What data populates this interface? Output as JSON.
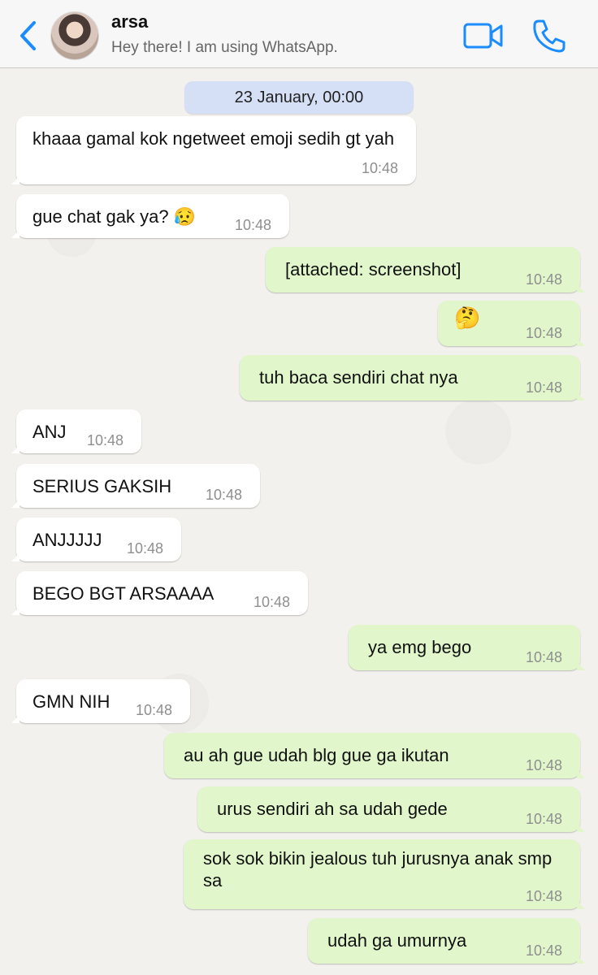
{
  "header": {
    "back_label": "Back",
    "contact_name": "arsa",
    "contact_status": "Hey there! I am using WhatsApp."
  },
  "chat": {
    "date_divider": "23 January, 00:00",
    "messages": [
      {
        "direction": "in",
        "text": " khaaa gamal kok ngetweet emoji sedih gt yah",
        "time": "10:48"
      },
      {
        "direction": "in",
        "text": "gue chat gak ya? 😥",
        "time": "10:48"
      },
      {
        "direction": "out",
        "text": "[attached: screenshot]",
        "time": "10:48"
      },
      {
        "direction": "out",
        "text": "🤔",
        "time": "10:48"
      },
      {
        "direction": "out",
        "text": "tuh baca sendiri chat nya",
        "time": "10:48"
      },
      {
        "direction": "in",
        "text": "ANJ",
        "time": "10:48"
      },
      {
        "direction": "in",
        "text": "SERIUS GAKSIH",
        "time": "10:48"
      },
      {
        "direction": "in",
        "text": "ANJJJJJ",
        "time": "10:48"
      },
      {
        "direction": "in",
        "text": "BEGO BGT ARSAAAA",
        "time": "10:48"
      },
      {
        "direction": "out",
        "text": "ya emg bego",
        "time": "10:48"
      },
      {
        "direction": "in",
        "text": "GMN NIH",
        "time": "10:48"
      },
      {
        "direction": "out",
        "text": "au ah gue udah blg gue ga ikutan",
        "time": "10:48"
      },
      {
        "direction": "out",
        "text": "urus sendiri ah sa udah gede",
        "time": "10:48"
      },
      {
        "direction": "out",
        "text": "sok sok bikin jealous tuh jurusnya anak smp sa",
        "time": "10:48"
      },
      {
        "direction": "out",
        "text": "udah ga umurnya",
        "time": "10:48"
      }
    ]
  },
  "colors": {
    "accent": "#1a8cff",
    "incoming_bubble": "#ffffff",
    "outgoing_bubble": "#e1f7cb",
    "date_pill": "#d5dff6"
  },
  "icons": {
    "back": "chevron-left-icon",
    "video": "video-camera-icon",
    "call": "phone-icon"
  }
}
